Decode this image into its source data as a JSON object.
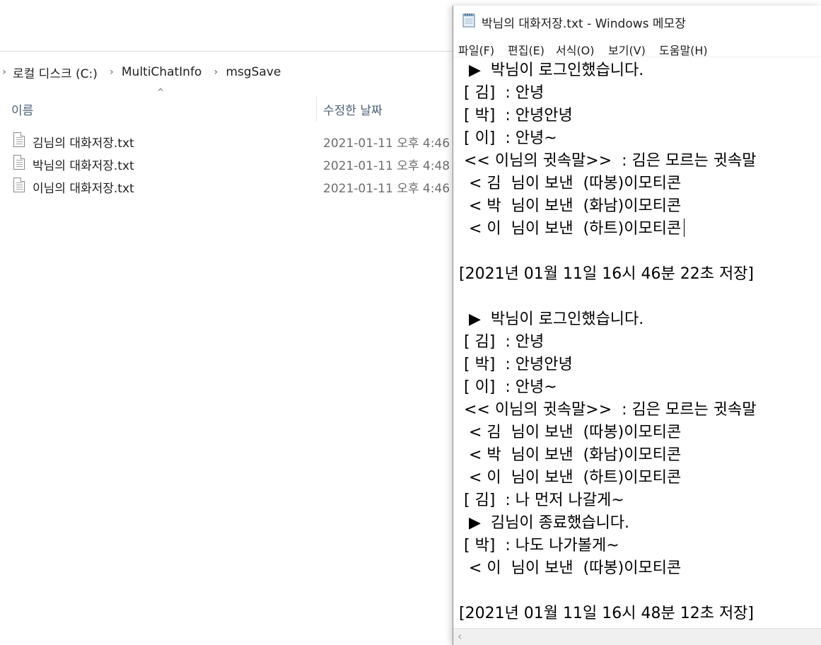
{
  "explorer": {
    "breadcrumb": [
      "로컬 디스크 (C:)",
      "MultiChatInfo",
      "msgSave"
    ],
    "columns": {
      "name": "이름",
      "date": "수정한 날짜"
    },
    "files": [
      {
        "name": "김님의 대화저장.txt",
        "date": "2021-01-11 오후 4:46"
      },
      {
        "name": "박님의 대화저장.txt",
        "date": "2021-01-11 오후 4:48"
      },
      {
        "name": "이님의 대화저장.txt",
        "date": "2021-01-11 오후 4:46"
      }
    ]
  },
  "notepad": {
    "title": "박님의 대화저장.txt - Windows 메모장",
    "menu": [
      "파일(F)",
      "편집(E)",
      "서식(O)",
      "보기(V)",
      "도움말(H)"
    ],
    "lines": [
      "  ▶  박님이 로그인했습니다.",
      " [ 김]  : 안녕",
      " [ 박]  : 안녕안녕",
      " [ 이]  : 안녕~",
      " << 이님의 귓속말>>  : 김은 모르는 귓속말",
      "  < 김  님이 보낸  (따봉)이모티콘",
      "  < 박  님이 보낸  (화남)이모티콘",
      "  < 이  님이 보낸  (하트)이모티콘",
      "",
      "[2021년 01월 11일 16시 46분 22초 저장]",
      "",
      "  ▶  박님이 로그인했습니다.",
      " [ 김]  : 안녕",
      " [ 박]  : 안녕안녕",
      " [ 이]  : 안녕~",
      " << 이님의 귓속말>>  : 김은 모르는 귓속말",
      "  < 김  님이 보낸  (따봉)이모티콘",
      "  < 박  님이 보낸  (화남)이모티콘",
      "  < 이  님이 보낸  (하트)이모티콘",
      " [ 김]  : 나 먼저 나갈게~",
      "  ▶  김님이 종료했습니다.",
      " [ 박]  : 나도 나가볼게~",
      "  < 이  님이 보낸  (따봉)이모티콘",
      "",
      "[2021년 01월 11일 16시 48분 12초 저장]"
    ]
  }
}
